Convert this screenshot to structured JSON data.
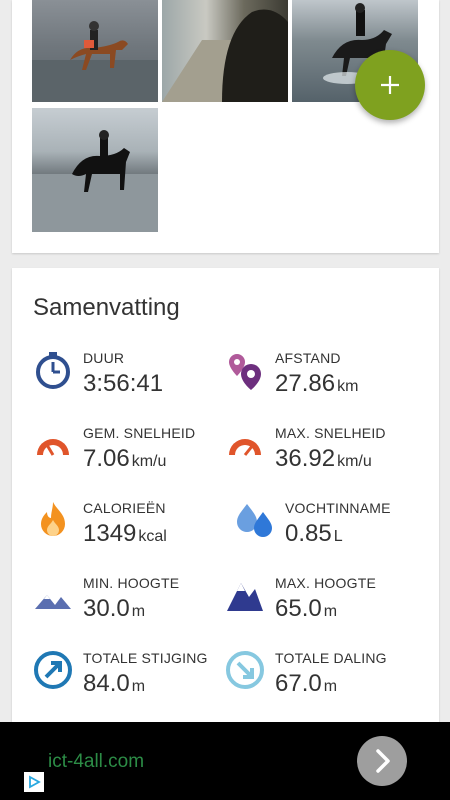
{
  "photos": [
    "horse-riding-photo-1",
    "path-photo-2",
    "horse-riding-photo-3",
    "horse-riding-photo-4"
  ],
  "fab": {
    "icon": "plus-icon",
    "color": "#7fa11f"
  },
  "summary": {
    "title": "Samenvatting",
    "stats": [
      {
        "label": "DUUR",
        "value": "3:56:41",
        "unit": "",
        "icon": "stopwatch-icon"
      },
      {
        "label": "AFSTAND",
        "value": "27.86",
        "unit": "km",
        "icon": "map-pin-icon"
      },
      {
        "label": "GEM. SNELHEID",
        "value": "7.06",
        "unit": "km/u",
        "icon": "speedometer-avg-icon"
      },
      {
        "label": "MAX. SNELHEID",
        "value": "36.92",
        "unit": "km/u",
        "icon": "speedometer-max-icon"
      },
      {
        "label": "CALORIEËN",
        "value": "1349",
        "unit": "kcal",
        "icon": "flame-icon"
      },
      {
        "label": "VOCHTINNAME",
        "value": "0.85",
        "unit": "L",
        "icon": "water-drops-icon"
      },
      {
        "label": "MIN. HOOGTE",
        "value": "30.0",
        "unit": "m",
        "icon": "mountain-low-icon"
      },
      {
        "label": "MAX. HOOGTE",
        "value": "65.0",
        "unit": "m",
        "icon": "mountain-high-icon"
      },
      {
        "label": "TOTALE STIJGING",
        "value": "84.0",
        "unit": "m",
        "icon": "ascent-arrow-icon"
      },
      {
        "label": "TOTALE DALING",
        "value": "67.0",
        "unit": "m",
        "icon": "descent-arrow-icon"
      }
    ]
  },
  "ad": {
    "text": "ict-4all.com",
    "icon": "chevron-right-icon",
    "badge": "ad-choices-icon"
  }
}
